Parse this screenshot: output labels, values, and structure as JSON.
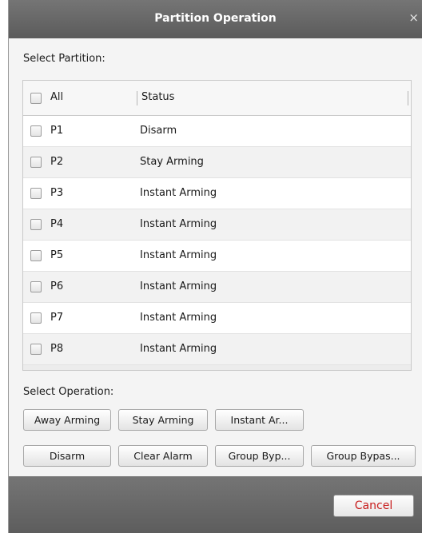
{
  "dialog": {
    "title": "Partition Operation",
    "close_glyph": "×"
  },
  "select_partition_label": "Select Partition:",
  "table": {
    "header": {
      "name": "All",
      "status": "Status"
    },
    "rows": [
      {
        "name": "P1",
        "status": "Disarm"
      },
      {
        "name": "P2",
        "status": "Stay Arming"
      },
      {
        "name": "P3",
        "status": "Instant Arming"
      },
      {
        "name": "P4",
        "status": "Instant Arming"
      },
      {
        "name": "P5",
        "status": "Instant Arming"
      },
      {
        "name": "P6",
        "status": "Instant Arming"
      },
      {
        "name": "P7",
        "status": "Instant Arming"
      },
      {
        "name": "P8",
        "status": "Instant Arming"
      }
    ]
  },
  "select_operation_label": "Select Operation:",
  "operations": {
    "away_arming": "Away Arming",
    "stay_arming": "Stay Arming",
    "instant_arming": "Instant Ar...",
    "disarm": "Disarm",
    "clear_alarm": "Clear Alarm",
    "group_bypass": "Group Byp...",
    "group_bypass_restore": "Group Bypas..."
  },
  "footer": {
    "cancel_label": "Cancel"
  },
  "colors": {
    "titlebar": "#666666",
    "cancel_text": "#c81e1e"
  },
  "icons": {
    "close": "close-icon",
    "checkbox": "checkbox-icon"
  }
}
